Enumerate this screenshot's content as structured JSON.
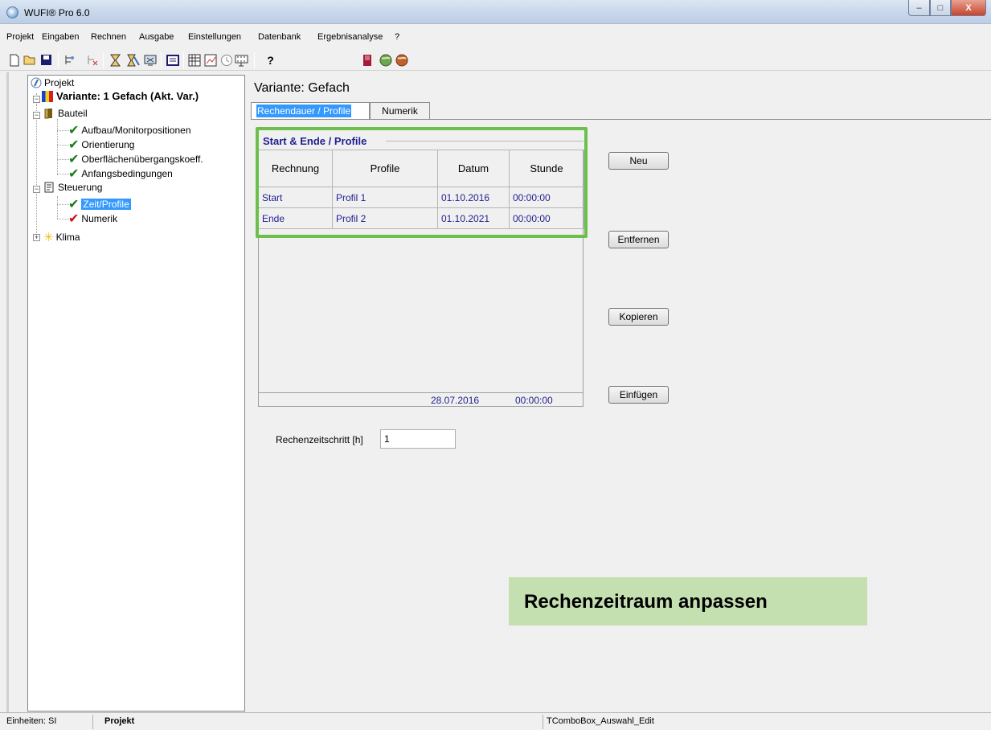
{
  "window": {
    "title": "WUFI® Pro 6.0",
    "minimize": "–",
    "maximize": "□",
    "close": "X"
  },
  "menu": [
    "Projekt",
    "Eingaben",
    "Rechnen",
    "Ausgabe",
    "Einstellungen",
    "Datenbank",
    "Ergebnisanalyse",
    "?"
  ],
  "toolbar": {
    "icons": [
      "new-file-icon",
      "open-folder-icon",
      "save-icon",
      "tree-add-icon",
      "tree-remove-icon",
      "hourglass-icon",
      "hourglass-multi-icon",
      "calc-icon",
      "table-icon",
      "grid-icon",
      "chart-icon",
      "clock-icon",
      "film-icon",
      "help-icon",
      "book-icon",
      "globe-green-icon",
      "globe-red-icon"
    ],
    "help_label": "?"
  },
  "tree": {
    "root": "Projekt",
    "variant": "Variante: 1 Gefach (Akt. Var.)",
    "bauteil": "Bauteil",
    "bauteil_children": [
      "Aufbau/Monitorpositionen",
      "Orientierung",
      "Oberflächenübergangskoeff.",
      "Anfangsbedingungen"
    ],
    "steuerung": "Steuerung",
    "zeit_profile": "Zeit/Profile",
    "numerik": "Numerik",
    "klima": "Klima"
  },
  "main": {
    "variant_label": "Variante:  Gefach",
    "tabs": [
      {
        "label": "Rechendauer / Profile",
        "active": true
      },
      {
        "label": "Numerik",
        "active": false
      }
    ],
    "group_title": "Start & Ende / Profile",
    "table": {
      "headers": [
        "Rechnung",
        "Profile",
        "Datum",
        "Stunde"
      ],
      "rows": [
        [
          "Start",
          "Profil 1",
          "01.10.2016",
          "00:00:00"
        ],
        [
          "Ende",
          "Profil 2",
          "01.10.2021",
          "00:00:00"
        ]
      ],
      "footer": {
        "datum": "28.07.2016",
        "stunde": "00:00:00"
      }
    },
    "buttons": {
      "neu": "Neu",
      "entfernen": "Entfernen",
      "kopieren": "Kopieren",
      "einfuegen": "Einfügen"
    },
    "step_label": "Rechenzeitschritt [h]",
    "step_value": "1",
    "callout": "Rechenzeitraum anpassen",
    "highlight_color": "#6cbf4a",
    "callout_color": "#c5e0b0",
    "selection_color": "#3399ff"
  },
  "status": {
    "units": "Einheiten: SI",
    "mode": "Projekt",
    "component": "TComboBox_Auswahl_Edit"
  }
}
